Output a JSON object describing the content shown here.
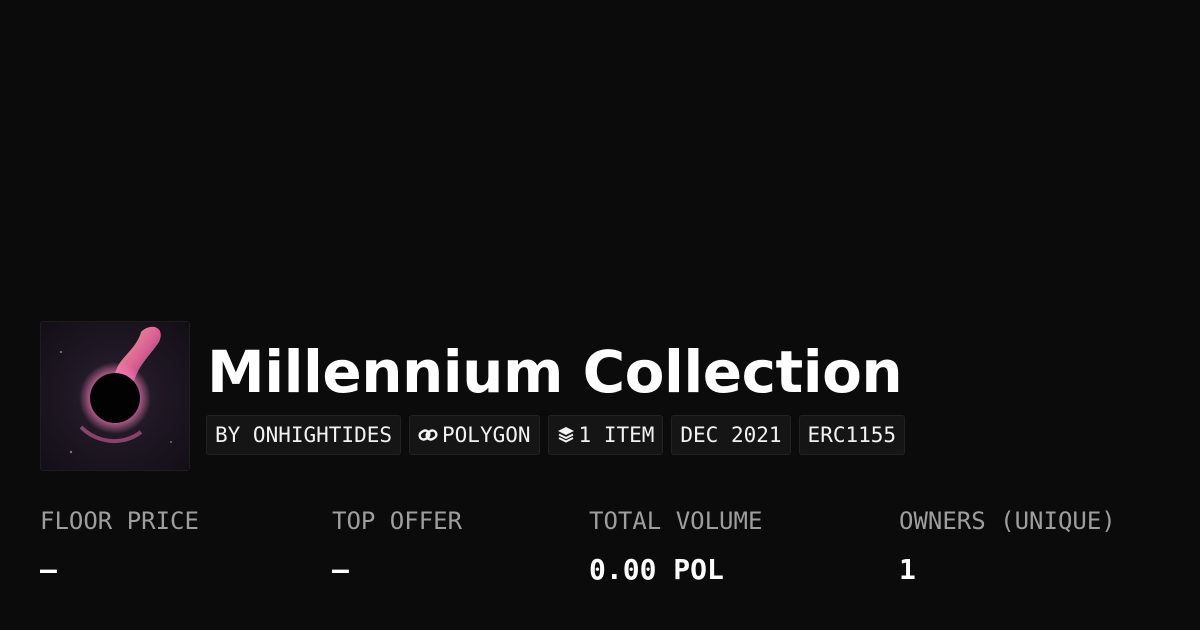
{
  "collection": {
    "title": "Millennium Collection",
    "avatar_icon": "black-hole-artwork"
  },
  "tags": {
    "creator": "BY ONHIGHTIDES",
    "chain": "POLYGON",
    "chain_icon": "polygon-link-icon",
    "items": "1 ITEM",
    "items_icon": "layers-icon",
    "date": "DEC 2021",
    "standard": "ERC1155"
  },
  "stats": {
    "floor_price": {
      "label": "FLOOR PRICE",
      "value": "–"
    },
    "top_offer": {
      "label": "TOP OFFER",
      "value": "–"
    },
    "total_volume": {
      "label": "TOTAL VOLUME",
      "value": "0.00 POL"
    },
    "owners": {
      "label": "OWNERS (UNIQUE)",
      "value": "1"
    }
  },
  "colors": {
    "background": "#0b0b0b",
    "tag_background": "#151515",
    "label_gray": "#9e9e9e",
    "text": "#ffffff"
  }
}
